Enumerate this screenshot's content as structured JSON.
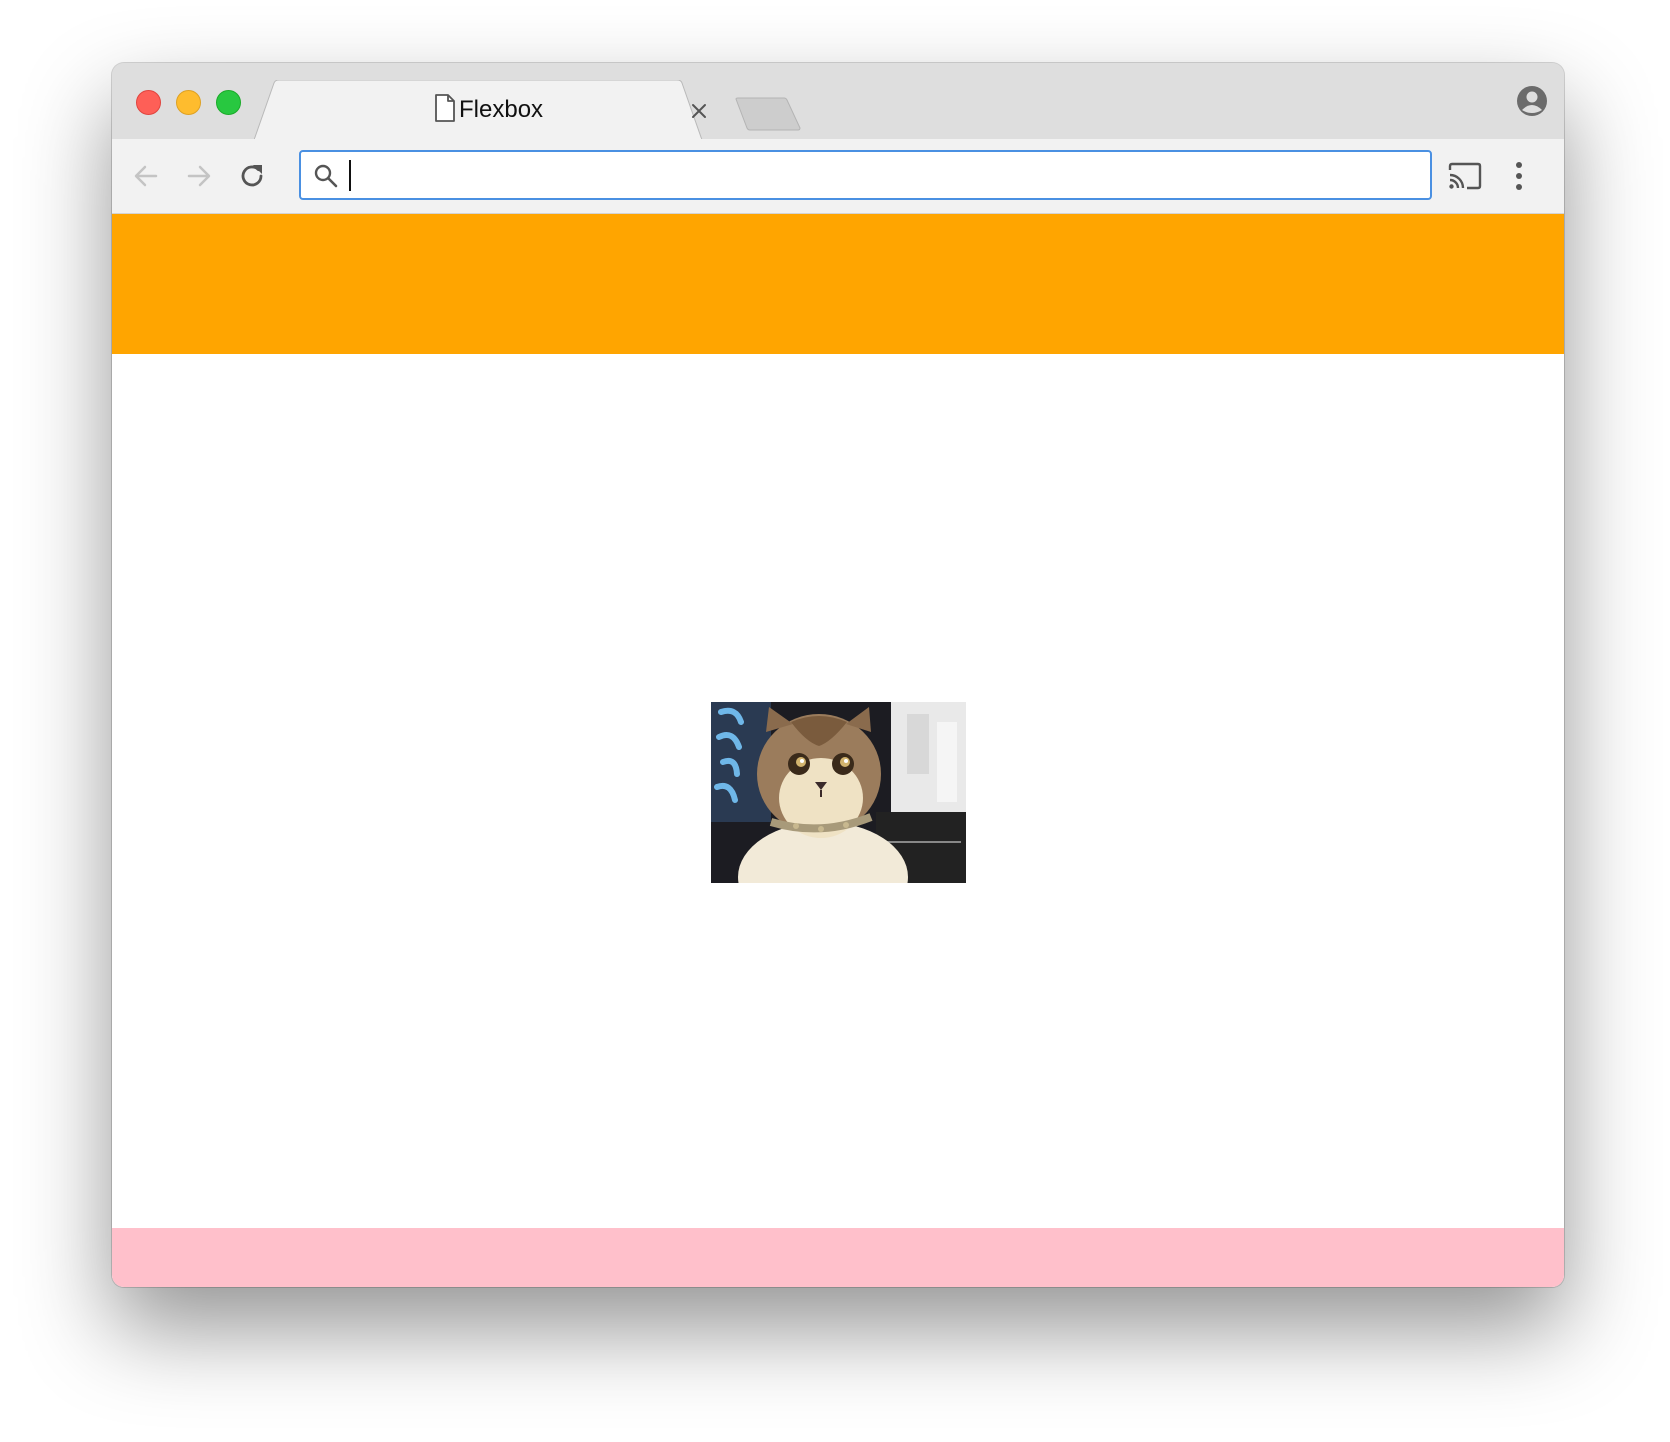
{
  "browser": {
    "tab": {
      "title": "Flexbox",
      "icon": "document-icon",
      "close_icon": "close-icon"
    },
    "new_tab_icon": "new-tab-icon",
    "profile_icon": "person-circle-icon",
    "toolbar": {
      "back_icon": "arrow-left-icon",
      "forward_icon": "arrow-right-icon",
      "reload_icon": "reload-icon",
      "cast_icon": "cast-icon",
      "menu_icon": "kebab-menu-icon"
    },
    "omnibox": {
      "value": "",
      "search_icon": "search-icon"
    }
  },
  "page": {
    "header_color": "#ffa500",
    "footer_color": "#ffc0cb",
    "main_color": "#ffffff",
    "image": {
      "subject": "cat",
      "alt": ""
    }
  },
  "colors": {
    "traffic_close": "#fe5f57",
    "traffic_minimize": "#febc2e",
    "traffic_maximize": "#28c840",
    "omnibox_focus": "#4a90e2"
  }
}
